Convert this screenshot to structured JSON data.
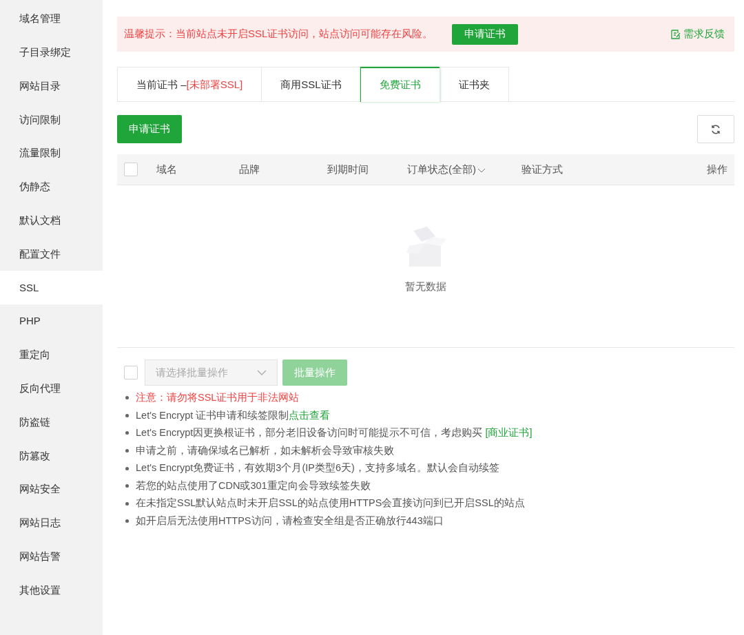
{
  "sidebar": {
    "items": [
      {
        "label": "域名管理",
        "selected": false
      },
      {
        "label": "子目录绑定",
        "selected": false
      },
      {
        "label": "网站目录",
        "selected": false
      },
      {
        "label": "访问限制",
        "selected": false
      },
      {
        "label": "流量限制",
        "selected": false
      },
      {
        "label": "伪静态",
        "selected": false
      },
      {
        "label": "默认文档",
        "selected": false
      },
      {
        "label": "配置文件",
        "selected": false
      },
      {
        "label": "SSL",
        "selected": true
      },
      {
        "label": "PHP",
        "selected": false
      },
      {
        "label": "重定向",
        "selected": false
      },
      {
        "label": "反向代理",
        "selected": false
      },
      {
        "label": "防盗链",
        "selected": false
      },
      {
        "label": "防篡改",
        "selected": false
      },
      {
        "label": "网站安全",
        "selected": false
      },
      {
        "label": "网站日志",
        "selected": false
      },
      {
        "label": "网站告警",
        "selected": false
      },
      {
        "label": "其他设置",
        "selected": false
      }
    ]
  },
  "alert": {
    "message": "温馨提示：当前站点未开启SSL证书访问，站点访问可能存在风险。",
    "button": "申请证书",
    "feedback": "需求反馈"
  },
  "tabs": [
    {
      "label": "当前证书 –",
      "status": "[未部署SSL]",
      "selected": false
    },
    {
      "label": "商用SSL证书",
      "selected": false
    },
    {
      "label": "免费证书",
      "selected": true
    },
    {
      "label": "证书夹",
      "selected": false
    }
  ],
  "toolbar": {
    "apply_button": "申请证书"
  },
  "table": {
    "select_all": {
      "checked": false
    },
    "columns": [
      "域名",
      "品牌",
      "到期时间",
      "订单状态(全部)",
      "验证方式",
      "操作"
    ],
    "empty_text": "暂无数据"
  },
  "bulk": {
    "checked": false,
    "placeholder": "请选择批量操作",
    "button": "批量操作",
    "disabled": true
  },
  "notes": [
    {
      "kind": "warning",
      "text": "注意：请勿将SSL证书用于非法网站"
    },
    {
      "kind": "plain",
      "text": "Let's Encrypt 证书申请和续签限制",
      "link": "点击查看"
    },
    {
      "kind": "plain",
      "text": "Let's Encrypt因更换根证书，部分老旧设备访问时可能提示不可信，考虑购买 ",
      "link": "[商业证书]"
    },
    {
      "kind": "plain",
      "text": "申请之前，请确保域名已解析，如未解析会导致审核失败"
    },
    {
      "kind": "plain",
      "text": "Let's Encrypt免费证书，有效期3个月(IP类型6天)，支持多域名。默认会自动续签"
    },
    {
      "kind": "plain",
      "text": "若您的站点使用了CDN或301重定向会导致续签失败"
    },
    {
      "kind": "plain",
      "text": "在未指定SSL默认站点时未开启SSL的站点使用HTTPS会直接访问到已开启SSL的站点"
    },
    {
      "kind": "plain",
      "text": "如开启后无法使用HTTPS访问，请检查安全组是否正确放行443端口"
    }
  ]
}
